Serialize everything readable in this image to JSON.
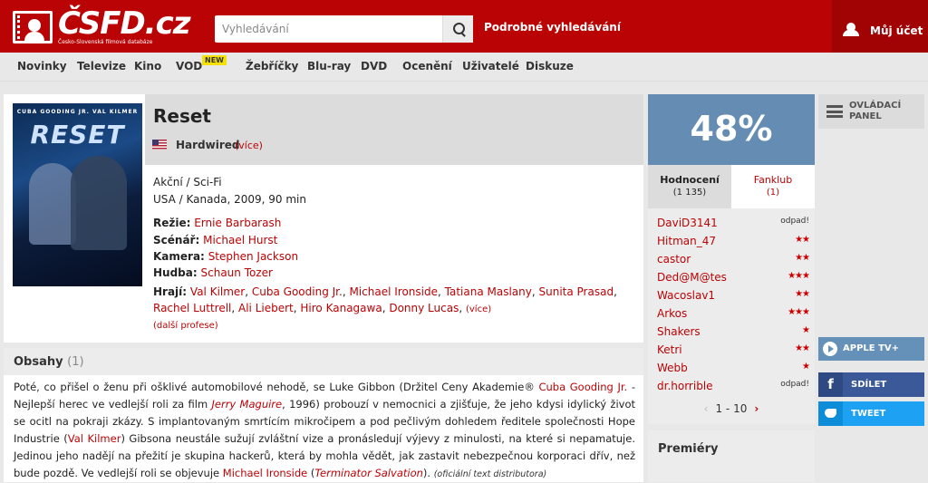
{
  "header": {
    "logo_text": "ČSFD.cz",
    "logo_subtitle": "Česko-Slovenská filmová databáze",
    "search_placeholder": "Vyhledávání",
    "advanced_search": "Podrobné vyhledávání",
    "account": "Můj účet"
  },
  "nav": {
    "items": [
      "Novinky",
      "Televize",
      "Kino",
      "VOD",
      "Žebříčky",
      "Blu-ray",
      "DVD",
      "Ocenění",
      "Uživatelé",
      "Diskuze"
    ],
    "new_badge": "NEW"
  },
  "film": {
    "poster_top": "CUBA GOODING JR.   VAL KILMER",
    "poster_title": "RESET",
    "title": "Reset",
    "alt_title": "Hardwired",
    "alt_more": "(více)",
    "genre": "Akční / Sci-Fi",
    "origin": "USA / Kanada, 2009, 90 min",
    "director_label": "Režie:",
    "director": "Ernie Barbarash",
    "writer_label": "Scénář:",
    "writer": "Michael Hurst",
    "camera_label": "Kamera:",
    "camera": "Stephen Jackson",
    "music_label": "Hudba:",
    "music": "Schaun Tozer",
    "cast_label": "Hrají:",
    "cast": [
      "Val Kilmer",
      "Cuba Gooding Jr.",
      "Michael Ironside",
      "Tatiana Maslany",
      "Sunita Prasad",
      "Rachel Luttrell",
      "Ali Liebert",
      "Hiro Kanagawa",
      "Donny Lucas"
    ],
    "cast_more": "(více)",
    "more_professions": "(další profese)"
  },
  "plot": {
    "title": "Obsahy",
    "count": "(1)",
    "t1": "Poté, co přišel o ženu při ošklivé automobilové nehodě, se Luke Gibbon (Držitel Ceny Akademie® ",
    "l1": "Cuba Gooding Jr.",
    "t2": " - Nejlepší herec ve vedlejší roli za film ",
    "l2": "Jerry Maguire",
    "t3": ", 1996) probouzí v nemocnici a zjišťuje, že jeho kdysi idylický život se ocitl na pokraji zkázy. S implantovaným smrtícím mikročipem a pod pečlivým dohledem ředitele společnosti Hope Industrie (",
    "l3": "Val Kilmer",
    "t4": ") Gibsona neustále sužují zvláštní vize a pronásledují výjevy z minulosti, na které si nepamatuje. Jedinou jeho nadějí na přežití je skupina hackerů, která by mohla vědět, jak zastavit nebezpečnou korporaci dřív, než bude pozdě. Ve vedlejší roli se objevuje ",
    "l4": "Michael Ironside",
    "t5": " (",
    "l5": "Terminator Salvation",
    "t6": "). ",
    "source": "(oficiální text distributora)"
  },
  "rating": {
    "percent": "48%",
    "tab_ratings": "Hodnocení",
    "tab_ratings_count": "(1 135)",
    "tab_fanclub": "Fanklub",
    "tab_fanclub_count": "(1)",
    "users": [
      {
        "name": "DaviD3141",
        "stars": "odpad!"
      },
      {
        "name": "Hitman_47",
        "stars": "★★"
      },
      {
        "name": "castor",
        "stars": "★★"
      },
      {
        "name": "Ded@M@tes",
        "stars": "★★★"
      },
      {
        "name": "Wacoslav1",
        "stars": "★★"
      },
      {
        "name": "Arkos",
        "stars": "★★★"
      },
      {
        "name": "Shakers",
        "stars": "★"
      },
      {
        "name": "Ketri",
        "stars": "★★"
      },
      {
        "name": "Webb",
        "stars": "★"
      },
      {
        "name": "dr.horrible",
        "stars": "odpad!"
      }
    ],
    "pager": "1 - 10"
  },
  "premieres": "Premiéry",
  "side": {
    "panel": "OVLÁDACÍ PANEL",
    "appletv": "APPLE TV+",
    "share": "SDÍLET",
    "tweet": "TWEET"
  },
  "colors": {
    "brand": "#ba0305",
    "rating_bg": "#658db4",
    "facebook": "#3b5998",
    "twitter": "#1da1f2"
  }
}
